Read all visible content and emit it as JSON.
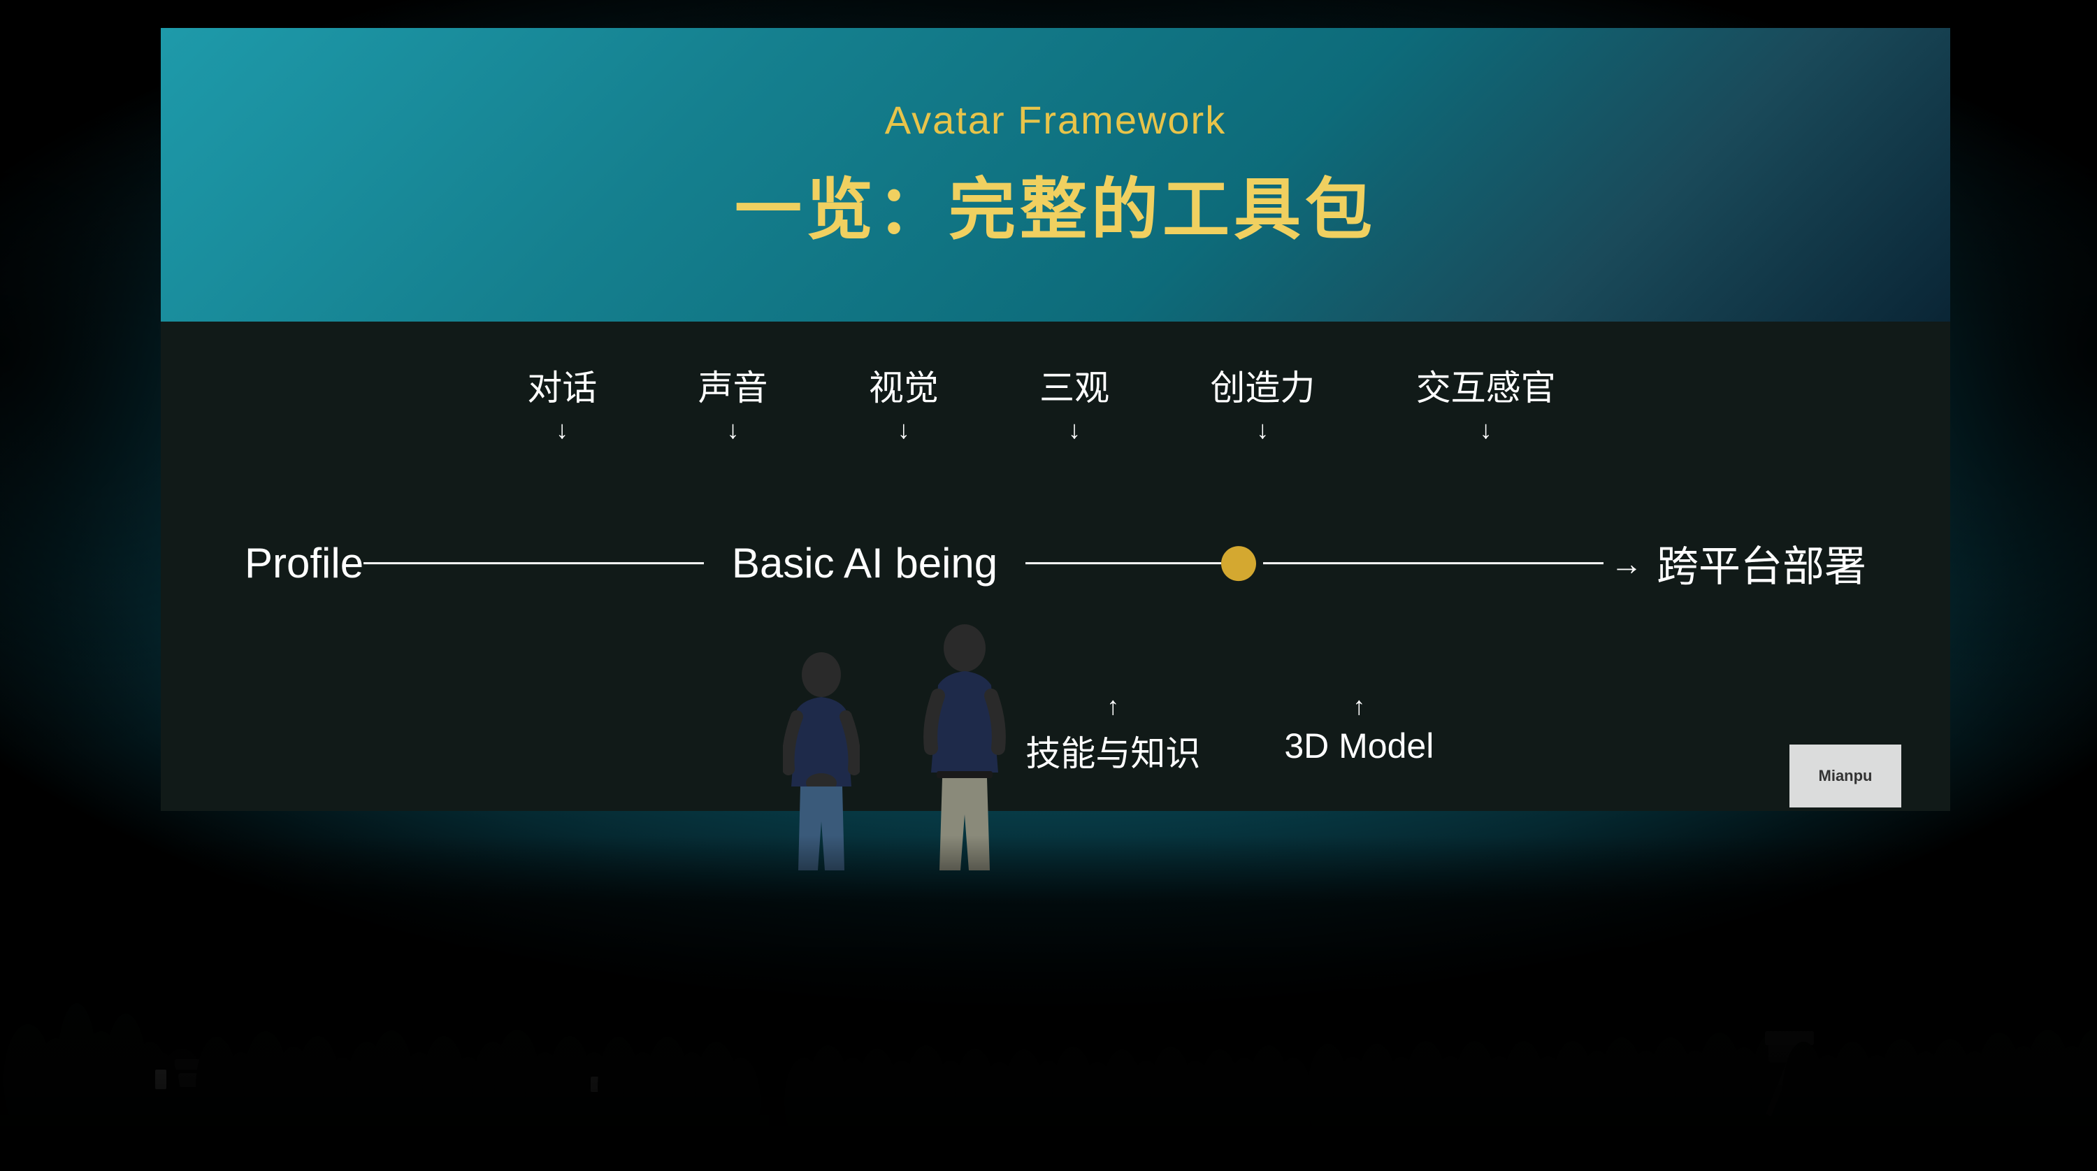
{
  "slide": {
    "title_en": "Avatar Framework",
    "title_zh": "一览：完整的工具包",
    "diagram": {
      "labels_above": [
        {
          "text": "对话",
          "arrow": "↓"
        },
        {
          "text": "声音",
          "arrow": "↓"
        },
        {
          "text": "视觉",
          "arrow": "↓"
        },
        {
          "text": "三观",
          "arrow": "↓"
        },
        {
          "text": "创造力",
          "arrow": "↓"
        },
        {
          "text": "交互感官",
          "arrow": "↓"
        }
      ],
      "node_profile": "Profile",
      "node_basic_ai": "Basic AI being",
      "node_cross_platform": "跨平台部署",
      "labels_below": [
        {
          "text": "技能与知识",
          "arrow": "↑"
        },
        {
          "text": "3D Model",
          "arrow": "↑"
        }
      ]
    }
  },
  "sign": {
    "text": "Mianpu"
  },
  "colors": {
    "title_gold": "#e8c44a",
    "title_gold2": "#f0d060",
    "slide_bg_top": "#1a8a9a",
    "slide_bg_dark": "#111a18",
    "circle_gold": "#d4a830",
    "text_white": "#ffffff"
  }
}
